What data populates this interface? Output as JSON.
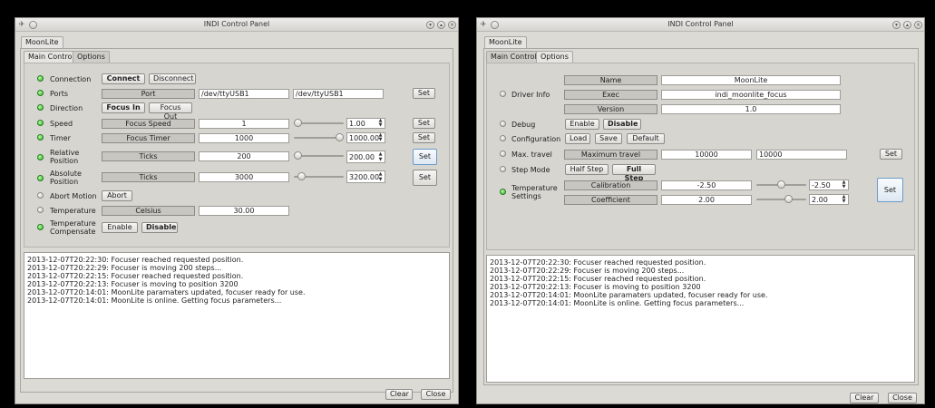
{
  "left": {
    "title": "INDI Control Panel",
    "device_tab": "MoonLite",
    "tabs": [
      "Main Control",
      "Options"
    ],
    "rows": [
      {
        "label": "Connection",
        "buttons": [
          "Connect",
          "Disconnect"
        ]
      },
      {
        "label": "Ports",
        "prop": "Port",
        "value": "/dev/ttyUSB1",
        "input": "/dev/ttyUSB1",
        "set": "Set"
      },
      {
        "label": "Direction",
        "buttons": [
          "Focus In",
          "Focus Out"
        ]
      },
      {
        "label": "Speed",
        "prop": "Focus Speed",
        "value": "1",
        "spin": "1.00",
        "set": "Set"
      },
      {
        "label": "Timer",
        "prop": "Focus Timer",
        "value": "1000",
        "spin": "1000.00",
        "set": "Set"
      },
      {
        "label": "Relative Position",
        "label_l1": "Relative",
        "label_l2": "Position",
        "prop": "Ticks",
        "value": "200",
        "spin": "200.00",
        "set": "Set"
      },
      {
        "label": "Absolute Position",
        "label_l1": "Absolute",
        "label_l2": "Position",
        "prop": "Ticks",
        "value": "3000",
        "spin": "3200.00",
        "set": "Set"
      },
      {
        "label": "Abort Motion",
        "buttons": [
          "Abort"
        ]
      },
      {
        "label": "Temperature",
        "prop": "Celsius",
        "value": "30.00"
      },
      {
        "label": "Temperature Compensate",
        "label_l1": "Temperature",
        "label_l2": "Compensate",
        "buttons": [
          "Enable",
          "Disable"
        ]
      }
    ],
    "log": [
      "2013-12-07T20:22:30: Focuser reached requested position.",
      "2013-12-07T20:22:29: Focuser is moving 200 steps...",
      "2013-12-07T20:22:15: Focuser reached requested position.",
      "2013-12-07T20:22:13: Focuser is moving to position 3200",
      "2013-12-07T20:14:01: MoonLite paramaters updated, focuser ready for use.",
      "2013-12-07T20:14:01: MoonLite is online. Getting focus parameters..."
    ],
    "clear": "Clear",
    "close": "Close"
  },
  "right": {
    "title": "INDI Control Panel",
    "device_tab": "MoonLite",
    "tabs": [
      "Main Control",
      "Options"
    ],
    "driver_info": {
      "label": "Driver Info",
      "props": [
        {
          "name": "Name",
          "value": "MoonLite"
        },
        {
          "name": "Exec",
          "value": "indi_moonlite_focus"
        },
        {
          "name": "Version",
          "value": "1.0"
        }
      ]
    },
    "debug": {
      "label": "Debug",
      "buttons": [
        "Enable",
        "Disable"
      ]
    },
    "configuration": {
      "label": "Configuration",
      "buttons": [
        "Load",
        "Save",
        "Default"
      ]
    },
    "max_travel": {
      "label": "Max. travel",
      "prop": "Maximum travel",
      "value": "10000",
      "input": "10000",
      "set": "Set"
    },
    "step_mode": {
      "label": "Step Mode",
      "buttons": [
        "Half Step",
        "Full Step"
      ]
    },
    "temp_settings": {
      "label_l1": "Temperature",
      "label_l2": "Settings",
      "props": [
        {
          "name": "Calibration",
          "value": "-2.50",
          "spin": "-2.50"
        },
        {
          "name": "Coefficient",
          "value": "2.00",
          "spin": "2.00"
        }
      ],
      "set": "Set"
    },
    "log": [
      "2013-12-07T20:22:30: Focuser reached requested position.",
      "2013-12-07T20:22:29: Focuser is moving 200 steps...",
      "2013-12-07T20:22:15: Focuser reached requested position.",
      "2013-12-07T20:22:13: Focuser is moving to position 3200",
      "2013-12-07T20:14:01: MoonLite paramaters updated, focuser ready for use.",
      "2013-12-07T20:14:01: MoonLite is online. Getting focus parameters..."
    ],
    "clear": "Clear",
    "close": "Close"
  }
}
